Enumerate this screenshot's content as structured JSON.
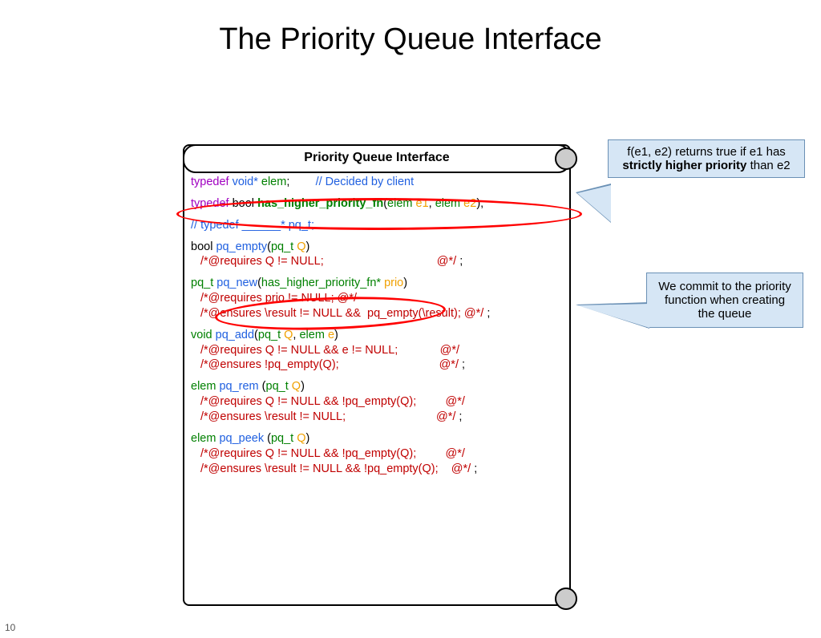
{
  "title": "The Priority Queue Interface",
  "pageNum": "10",
  "panelTitle": "Priority Queue Interface",
  "callout1": {
    "line1": "f(e1, e2) returns true if e1 has",
    "bold": "strictly higher priority",
    "line2": "than e2"
  },
  "callout2": "We commit to the priority function when creating the queue",
  "c": {
    "typedef": "typedef",
    "voidstar": "void*",
    "elem": "elem",
    "decided": "// Decided by client",
    "bool": "bool",
    "hhpfn": "has_higher_priority_fn",
    "e1": "e1",
    "e2": "e2",
    "tdpqt": "// typedef ______* pq_t;",
    "pqempty": "pq_empty",
    "pqt": "pq_t",
    "Q": "Q",
    "reqQnn": "/*@requires Q != NULL;",
    "atc": "@*/",
    "atc2": "@*/",
    "pqnew": "pq_new",
    "hhpfnstar": "has_higher_priority_fn*",
    "prio": "prio",
    "reqprio": "/*@requires prio != NULL; @*/",
    "ensresnew": "/*@ensures \\result != NULL &&  pq_empty(\\result); @*/",
    "void": "void",
    "pqadd": "pq_add",
    "e": "e",
    "reqQenn": "/*@requires Q != NULL && e != NULL;",
    "ensnotempty": "/*@ensures !pq_empty(Q);",
    "pqrem": "pq_rem",
    "reqQne": "/*@requires Q != NULL && !pq_empty(Q);",
    "ensresnn": "/*@ensures \\result != NULL;",
    "pqpeek": "pq_peek",
    "ensresne": "/*@ensures \\result != NULL && !pq_empty(Q);"
  }
}
